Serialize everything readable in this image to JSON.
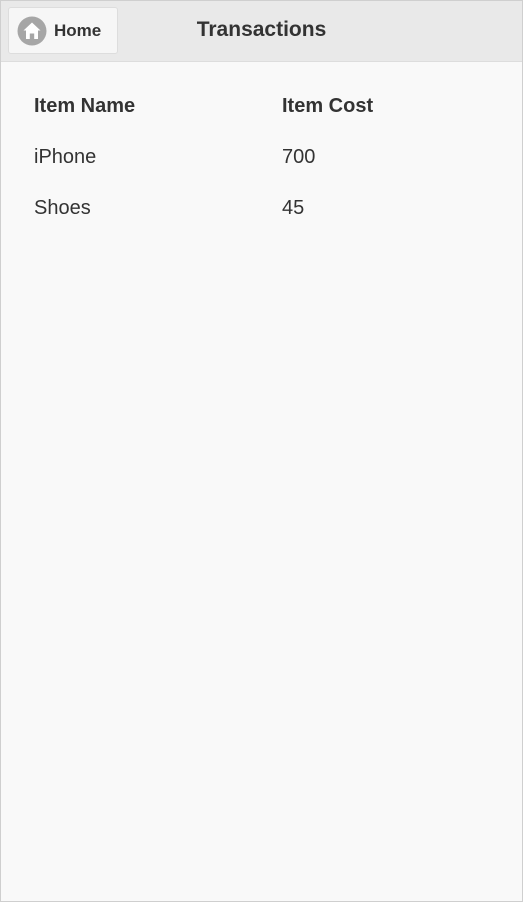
{
  "header": {
    "home_label": "Home",
    "title": "Transactions",
    "home_icon": "home-icon"
  },
  "table": {
    "columns": [
      "Item Name",
      "Item Cost"
    ],
    "rows": [
      [
        "iPhone",
        "700"
      ],
      [
        "Shoes",
        "45"
      ]
    ]
  },
  "colors": {
    "header_bg": "#e9e9e9",
    "page_bg": "#f9f9f9",
    "text": "#333333",
    "icon_bg": "#a6a6a6"
  }
}
